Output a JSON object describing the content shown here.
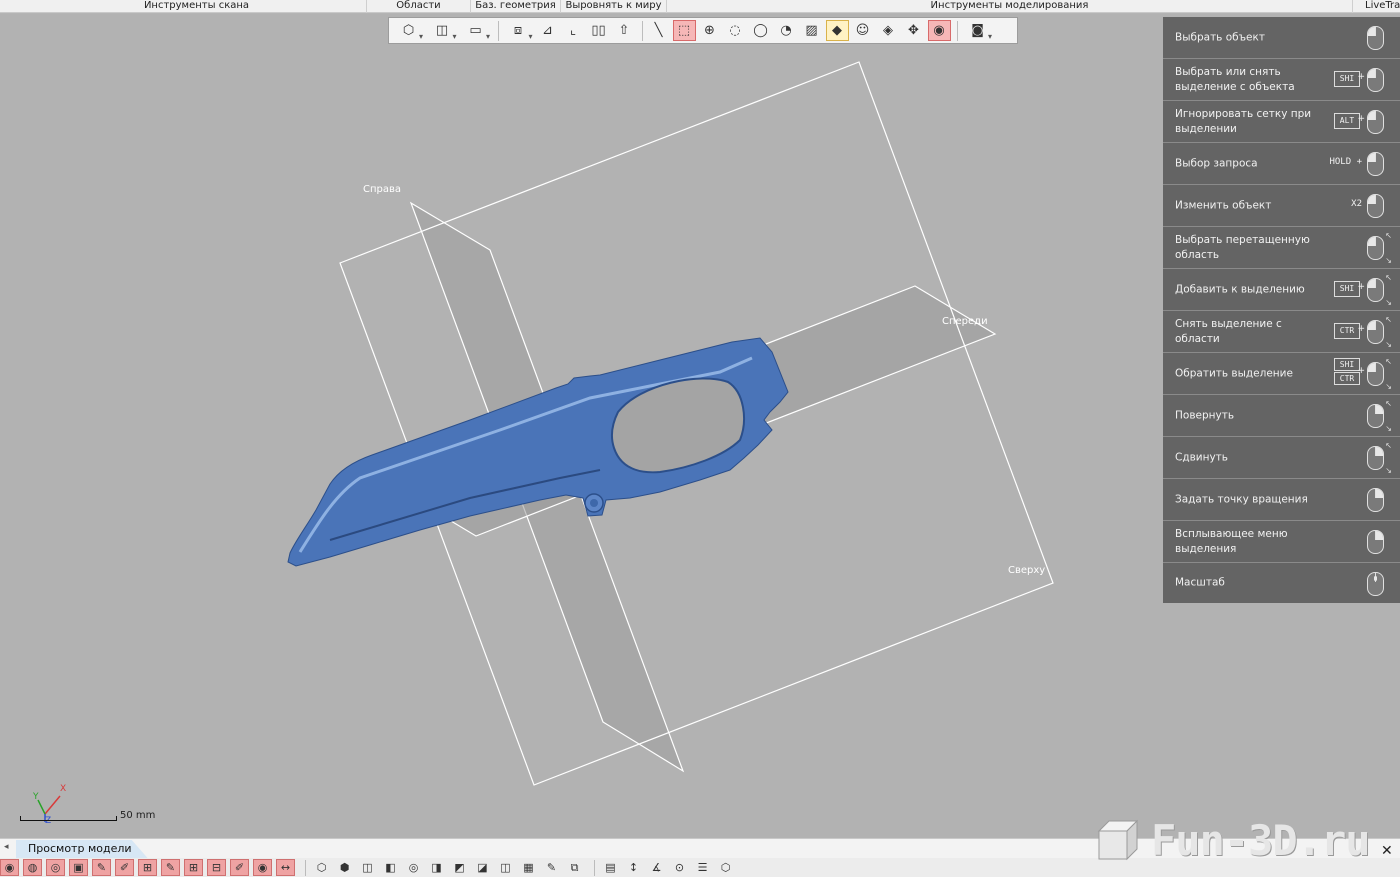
{
  "ribbon": {
    "scan_tools": "Инструменты скана",
    "regions": "Области",
    "base_geometry": "Баз. геометрия",
    "align_to_world": "Выровнять к миру",
    "modeling_tools": "Инструменты моделирования",
    "livetrans": "LiveTran"
  },
  "viewport": {
    "plane_right": "Справа",
    "plane_front": "Спереди",
    "plane_top": "Сверху",
    "axis_x": "X",
    "axis_y": "Y",
    "axis_z": "Z",
    "model_color": "#4a74b8",
    "background_color": "#b2b2b2"
  },
  "toolbar": {
    "icons": [
      "region-select-icon",
      "box-icon",
      "plane-icon",
      "cube-view-icon",
      "align-icon",
      "corner-icon",
      "mirror-icon",
      "extrude-icon",
      "line-tool-icon",
      "rect-select-icon",
      "circle-select-icon",
      "brush-select-icon",
      "lasso-select-icon",
      "paint-select-icon",
      "freeform-select-icon",
      "fill-icon",
      "face-select-icon",
      "grow-select-icon",
      "move-icon",
      "visibility-icon",
      "render-mode-icon"
    ]
  },
  "hints": [
    {
      "label": "Выбрать объект",
      "mouse": "l"
    },
    {
      "label": "Выбрать или снять выделение с объекта",
      "keys": [
        "SHI"
      ],
      "mouse": "l"
    },
    {
      "label": "Игнорировать сетку при выделении",
      "keys": [
        "ALT"
      ],
      "mouse": "l"
    },
    {
      "label": "Выбор запроса",
      "text_key": "HOLD",
      "mouse": "l"
    },
    {
      "label": "Изменить объект",
      "text_key": "X2",
      "mouse": "l"
    },
    {
      "label": "Выбрать перетащенную область",
      "mouse": "l",
      "drag": true
    },
    {
      "label": "Добавить к выделению",
      "keys": [
        "SHI"
      ],
      "mouse": "l",
      "drag": true
    },
    {
      "label": "Снять выделение с области",
      "keys": [
        "CTR"
      ],
      "mouse": "l",
      "drag": true
    },
    {
      "label": "Обратить выделение",
      "keys": [
        "SHI",
        "CTR"
      ],
      "mouse": "l",
      "drag": true
    },
    {
      "label": "Повернуть",
      "mouse": "r",
      "drag": true
    },
    {
      "label": "Сдвинуть",
      "mouse": "r",
      "drag": true
    },
    {
      "label": "Задать точку вращения",
      "mouse": "r"
    },
    {
      "label": "Всплывающее меню выделения",
      "mouse": "r"
    },
    {
      "label": "Масштаб",
      "mouse": "m"
    }
  ],
  "scale": {
    "label": "50 mm"
  },
  "tabs": {
    "model_view": "Просмотр модели"
  },
  "watermark": {
    "text": "Fun-3D.ru"
  },
  "bottom_toolbar": {
    "group1": [
      "show-icon",
      "mesh-icon",
      "hide-icon",
      "show-all-icon",
      "edit-icon",
      "pen-icon",
      "grid-icon",
      "pen2-icon",
      "grid2-icon",
      "section-icon",
      "pen3-icon",
      "eye-icon",
      "measure-icon"
    ],
    "group2": [
      "cube1-icon",
      "cube2-icon",
      "cube3-icon",
      "cube4-icon",
      "cube5-icon",
      "cube6-icon",
      "cube7-icon",
      "cube8-icon",
      "cube9-icon",
      "cube10-icon",
      "cube11-icon",
      "cube12-icon"
    ],
    "group3": [
      "page-icon",
      "measure2-icon",
      "dimension-icon",
      "target-icon",
      "layers-icon",
      "shape-icon"
    ]
  }
}
